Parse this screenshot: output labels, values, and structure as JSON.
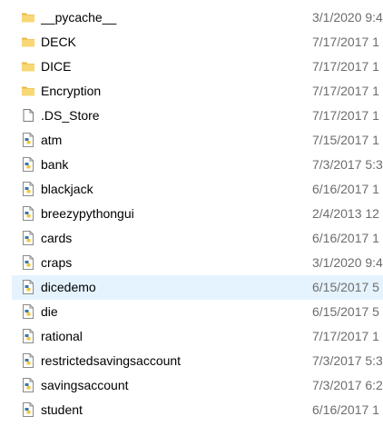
{
  "files": [
    {
      "name": "__pycache__",
      "date": "3/1/2020 9:4",
      "type": "folder",
      "icon": "folder-icon"
    },
    {
      "name": "DECK",
      "date": "7/17/2017 1",
      "type": "folder",
      "icon": "folder-icon"
    },
    {
      "name": "DICE",
      "date": "7/17/2017 1",
      "type": "folder",
      "icon": "folder-icon"
    },
    {
      "name": "Encryption",
      "date": "7/17/2017 1",
      "type": "folder",
      "icon": "folder-icon"
    },
    {
      "name": ".DS_Store",
      "date": "7/17/2017 1",
      "type": "file",
      "icon": "blank-file-icon"
    },
    {
      "name": "atm",
      "date": "7/15/2017 1",
      "type": "python",
      "icon": "python-file-icon"
    },
    {
      "name": "bank",
      "date": "7/3/2017 5:3",
      "type": "python",
      "icon": "python-file-icon"
    },
    {
      "name": "blackjack",
      "date": "6/16/2017 1",
      "type": "python",
      "icon": "python-file-icon"
    },
    {
      "name": "breezypythongui",
      "date": "2/4/2013 12",
      "type": "python",
      "icon": "python-file-icon"
    },
    {
      "name": "cards",
      "date": "6/16/2017 1",
      "type": "python",
      "icon": "python-file-icon"
    },
    {
      "name": "craps",
      "date": "3/1/2020 9:4",
      "type": "python",
      "icon": "python-file-icon"
    },
    {
      "name": "dicedemo",
      "date": "6/15/2017 5",
      "type": "python",
      "icon": "python-file-icon",
      "selected": true
    },
    {
      "name": "die",
      "date": "6/15/2017 5",
      "type": "python",
      "icon": "python-file-icon"
    },
    {
      "name": "rational",
      "date": "7/17/2017 1",
      "type": "python",
      "icon": "python-file-icon"
    },
    {
      "name": "restrictedsavingsaccount",
      "date": "7/3/2017 5:3",
      "type": "python",
      "icon": "python-file-icon"
    },
    {
      "name": "savingsaccount",
      "date": "7/3/2017 6:2",
      "type": "python",
      "icon": "python-file-icon"
    },
    {
      "name": "student",
      "date": "6/16/2017 1",
      "type": "python",
      "icon": "python-file-icon"
    }
  ],
  "colors": {
    "folder": "#f8d775",
    "selected_row": "#e5f3ff",
    "date_text": "#6d6d6d",
    "python_blue": "#3b77a8",
    "python_yellow": "#f2c73c"
  }
}
